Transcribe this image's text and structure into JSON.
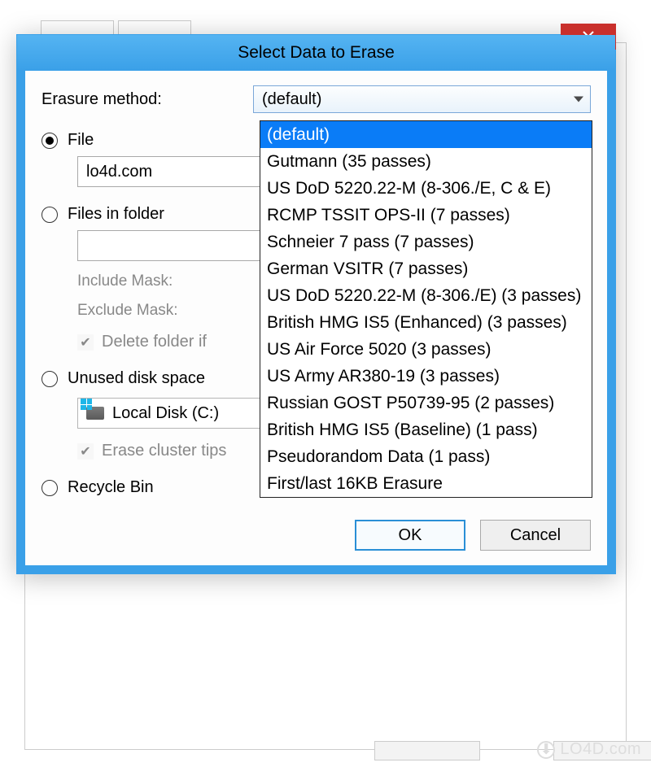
{
  "dialog": {
    "title": "Select Data to Erase",
    "erasure_label": "Erasure method:",
    "erasure_selected": "(default)",
    "methods": [
      "(default)",
      "Gutmann (35 passes)",
      "US DoD 5220.22-M (8-306./E, C & E)",
      "RCMP TSSIT OPS-II (7 passes)",
      "Schneier 7 pass (7 passes)",
      "German VSITR (7 passes)",
      "US DoD 5220.22-M (8-306./E) (3 passes)",
      "British HMG IS5 (Enhanced) (3 passes)",
      "US Air Force 5020 (3 passes)",
      "US Army AR380-19 (3 passes)",
      "Russian GOST P50739-95 (2 passes)",
      "British HMG IS5 (Baseline) (1 pass)",
      "Pseudorandom Data (1 pass)",
      "First/last 16KB Erasure"
    ],
    "radios": {
      "file": "File",
      "files_in_folder": "Files in folder",
      "unused": "Unused disk space",
      "recycle": "Recycle Bin",
      "selected": "file"
    },
    "file_value": "lo4d.com",
    "include_mask_label": "Include Mask:",
    "exclude_mask_label": "Exclude Mask:",
    "delete_folder_label": "Delete folder if",
    "disk_label": "Local Disk (C:)",
    "erase_cluster_label": "Erase cluster tips",
    "ok": "OK",
    "cancel": "Cancel"
  },
  "watermark": "LO4D.com"
}
